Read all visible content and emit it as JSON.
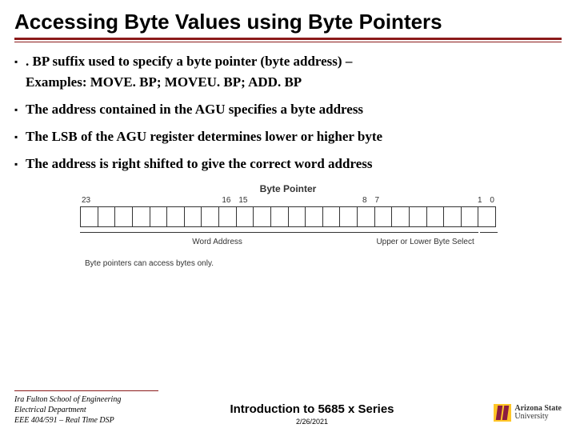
{
  "title": "Accessing Byte Values using Byte Pointers",
  "bullets": {
    "b1": ". BP suffix used to specify a byte pointer (byte address) –",
    "b1_sub": "Examples: MOVE. BP; MOVEU. BP; ADD. BP",
    "b2": "The address contained in the AGU specifies a byte address",
    "b3": "The LSB of the AGU register determines lower or higher byte",
    "b4": "The address is right shifted to give the correct word address"
  },
  "diagram": {
    "title": "Byte Pointer",
    "bit_23": "23",
    "bit_16": "16",
    "bit_15": "15",
    "bit_8": "8",
    "bit_7": "7",
    "bit_1": "1",
    "bit_0": "0",
    "label_word": "Word Address",
    "label_byte": "Upper or Lower Byte Select",
    "caption": "Byte pointers can access bytes only."
  },
  "footer": {
    "line1": "Ira Fulton School of Engineering",
    "line2": "Electrical Department",
    "line3": "EEE 404/591 – Real Time DSP",
    "center_title": "Introduction to 5685 x Series",
    "date": "2/26/2021",
    "logo_line1": "Arizona State",
    "logo_line2": "University"
  }
}
